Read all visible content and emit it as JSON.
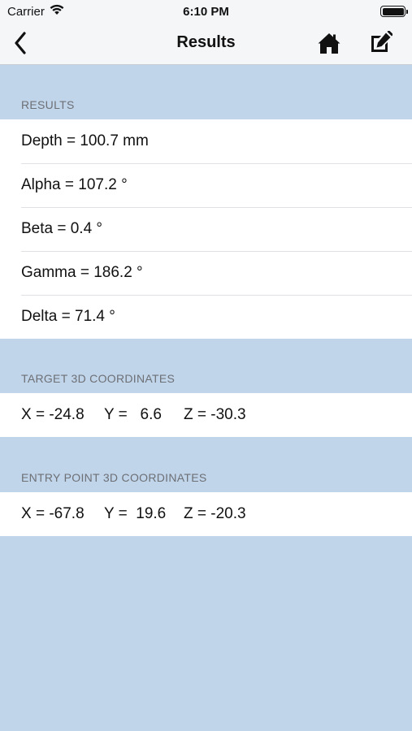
{
  "status_bar": {
    "carrier": "Carrier",
    "time": "6:10 PM"
  },
  "nav": {
    "title": "Results",
    "back_icon": "chevron-left-icon",
    "home_icon": "home-icon",
    "edit_icon": "edit-icon"
  },
  "results": {
    "header": "RESULTS",
    "rows": [
      "Depth = 100.7 mm",
      "Alpha = 107.2 °",
      "Beta = 0.4 °",
      "Gamma = 186.2 °",
      "Delta = 71.4 °"
    ]
  },
  "target": {
    "header": "TARGET 3D COORDINATES",
    "x": "X = -24.8",
    "y": "Y =   6.6",
    "z": "Z = -30.3"
  },
  "entry": {
    "header": "ENTRY POINT 3D COORDINATES",
    "x": "X = -67.8",
    "y": "Y =  19.6",
    "z": "Z = -20.3"
  },
  "colors": {
    "background": "#c0d4ea",
    "bar": "#f4f6f8",
    "cell": "#ffffff"
  }
}
